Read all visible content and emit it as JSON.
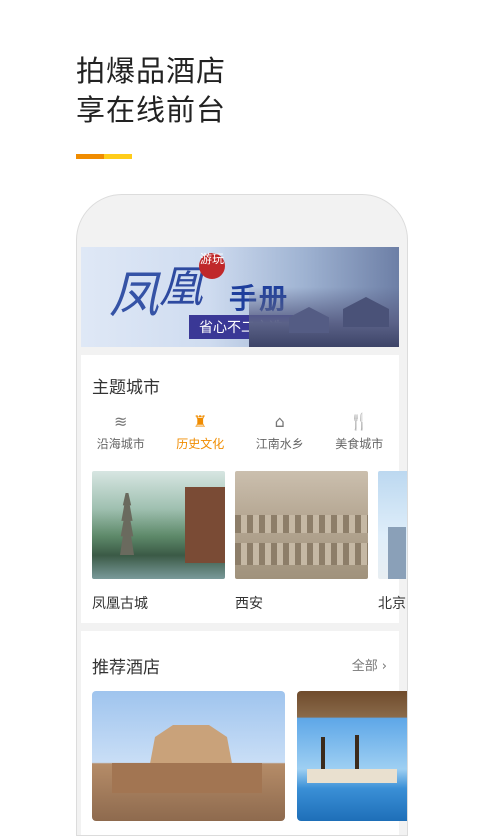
{
  "headline": {
    "line1": "拍爆品酒店",
    "line2": "享在线前台"
  },
  "colors": {
    "accent_orange": "#f08c00",
    "accent_yellow": "#ffcc1a"
  },
  "banner": {
    "feng": "凤",
    "huang": "凰",
    "seal": "游玩",
    "title": "手册",
    "slogan": "省心不二之选"
  },
  "theme_section": {
    "title": "主题城市",
    "tabs": [
      {
        "label": "沿海城市",
        "icon": "coast-icon",
        "active": false
      },
      {
        "label": "历史文化",
        "icon": "history-icon",
        "active": true
      },
      {
        "label": "江南水乡",
        "icon": "water-town-icon",
        "active": false
      },
      {
        "label": "美食城市",
        "icon": "food-icon",
        "active": false
      }
    ],
    "cities": [
      {
        "name": "凤凰古城"
      },
      {
        "name": "西安"
      },
      {
        "name": "北京"
      }
    ]
  },
  "hotel_section": {
    "title": "推荐酒店",
    "all_label": "全部"
  }
}
